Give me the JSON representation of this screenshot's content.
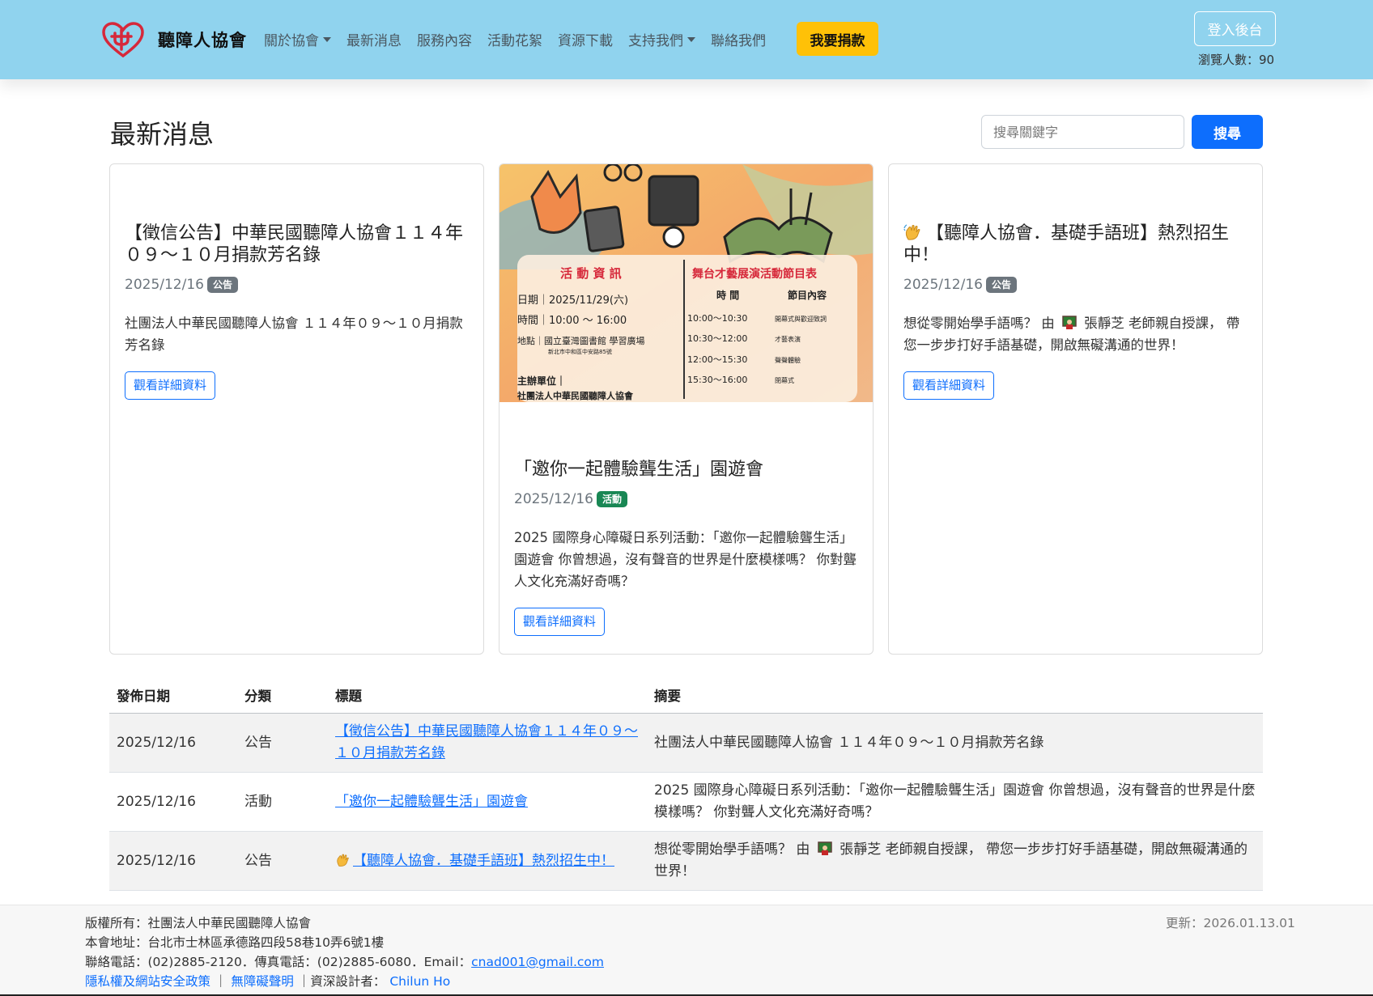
{
  "header": {
    "brand": "聽障人協會",
    "nav": [
      {
        "label": "關於協會",
        "dropdown": true
      },
      {
        "label": "最新消息",
        "dropdown": false
      },
      {
        "label": "服務內容",
        "dropdown": false
      },
      {
        "label": "活動花絮",
        "dropdown": false
      },
      {
        "label": "資源下載",
        "dropdown": false
      },
      {
        "label": "支持我們",
        "dropdown": true
      },
      {
        "label": "聯絡我們",
        "dropdown": false
      }
    ],
    "donate_label": "我要捐款",
    "login_label": "登入後台",
    "visitors": "瀏覽人數：90",
    "logo_icon": "heart-hand-logo-icon",
    "accent_color": "#90d3ee"
  },
  "main": {
    "title": "最新消息",
    "search": {
      "placeholder": "搜尋關鍵字",
      "button": "搜尋"
    },
    "cards": [
      {
        "title": "【徵信公告】中華民國聽障人協會１１４年０９～１０月捐款芳名錄",
        "date": "2025/12/16",
        "badge": "公告",
        "text": "社團法人中華民國聽障人協會 １１４年０９～１０月捐款芳名錄",
        "button": "觀看詳細資料"
      },
      {
        "title": "「邀你一起體驗聾生活」園遊會",
        "date": "2025/12/16",
        "badge": "活動",
        "text": "2025 國際身心障礙日系列活動：「邀你一起體驗聾生活」園遊會 你曾想過，沒有聲音的世界是什麼模樣嗎？ 你對聾人文化充滿好奇嗎？",
        "button": "觀看詳細資料",
        "poster": {
          "left_heading": "活 動 資 訊",
          "right_heading": "舞台才藝展演活動節目表",
          "date_line": "日期｜2025/11/29(六)",
          "time_line": "時間｜10:00 ～ 16:00",
          "place_line": "地點｜國立臺灣圖書館 學習廣場",
          "address_line": "新北市中和區中安路85號",
          "organizer_label": "主辦單位｜",
          "organizer": "社團法人中華民國聽障人協會",
          "col_time": "時 間",
          "col_program": "節目內容",
          "schedule": [
            {
              "time": "10:00～10:30",
              "item": "開幕式與歡迎致詞"
            },
            {
              "time": "10:30～12:00",
              "item": "才藝表演"
            },
            {
              "time": "12:00～15:30",
              "item": "聲聲體驗"
            },
            {
              "time": "15:30～16:00",
              "item": "閉幕式"
            }
          ]
        }
      },
      {
        "title": "【聽障人協會．基礎手語班】熱烈招生中！",
        "date": "2025/12/16",
        "badge": "公告",
        "text_before": "想從零開始學手語嗎？ 由",
        "text_after": "張靜芝 老師親自授課， 帶您一步步打好手語基礎，開啟無礙溝通的世界！",
        "button": "觀看詳細資料"
      }
    ]
  },
  "table": {
    "headers": [
      "發佈日期",
      "分類",
      "標題",
      "摘要"
    ],
    "rows": [
      {
        "date": "2025/12/16",
        "category": "公告",
        "title": "【徵信公告】中華民國聽障人協會１１４年０９～１０月捐款芳名錄",
        "summary": "社團法人中華民國聽障人協會 １１４年０９～１０月捐款芳名錄"
      },
      {
        "date": "2025/12/16",
        "category": "活動",
        "title": "「邀你一起體驗聾生活」園遊會",
        "summary": "2025 國際身心障礙日系列活動：「邀你一起體驗聾生活」園遊會 你曾想過，沒有聲音的世界是什麼模樣嗎？ 你對聾人文化充滿好奇嗎？"
      },
      {
        "date": "2025/12/16",
        "category": "公告",
        "title": "【聽障人協會．基礎手語班】熱烈招生中！",
        "summary_before": "想從零開始學手語嗎？ 由",
        "summary_after": "張靜芝 老師親自授課， 帶您一步步打好手語基礎，開啟無礙溝通的世界！"
      }
    ]
  },
  "footer": {
    "copyright": "版權所有：社團法人中華民國聽障人協會",
    "address": "本會地址：台北市士林區承德路四段58巷10弄6號1樓",
    "contact_prefix": "聯絡電話：(02)2885-2120．傳真電話：(02)2885-6080．Email：",
    "email": "cnad001@gmail.com",
    "privacy_link": "隱私權及網站安全政策",
    "separator": "｜",
    "accessibility_link": "無障礙聲明",
    "designer_label": "｜資深設計者：",
    "designer": "Chilun Ho",
    "updated": "更新：2026.01.13.01"
  }
}
